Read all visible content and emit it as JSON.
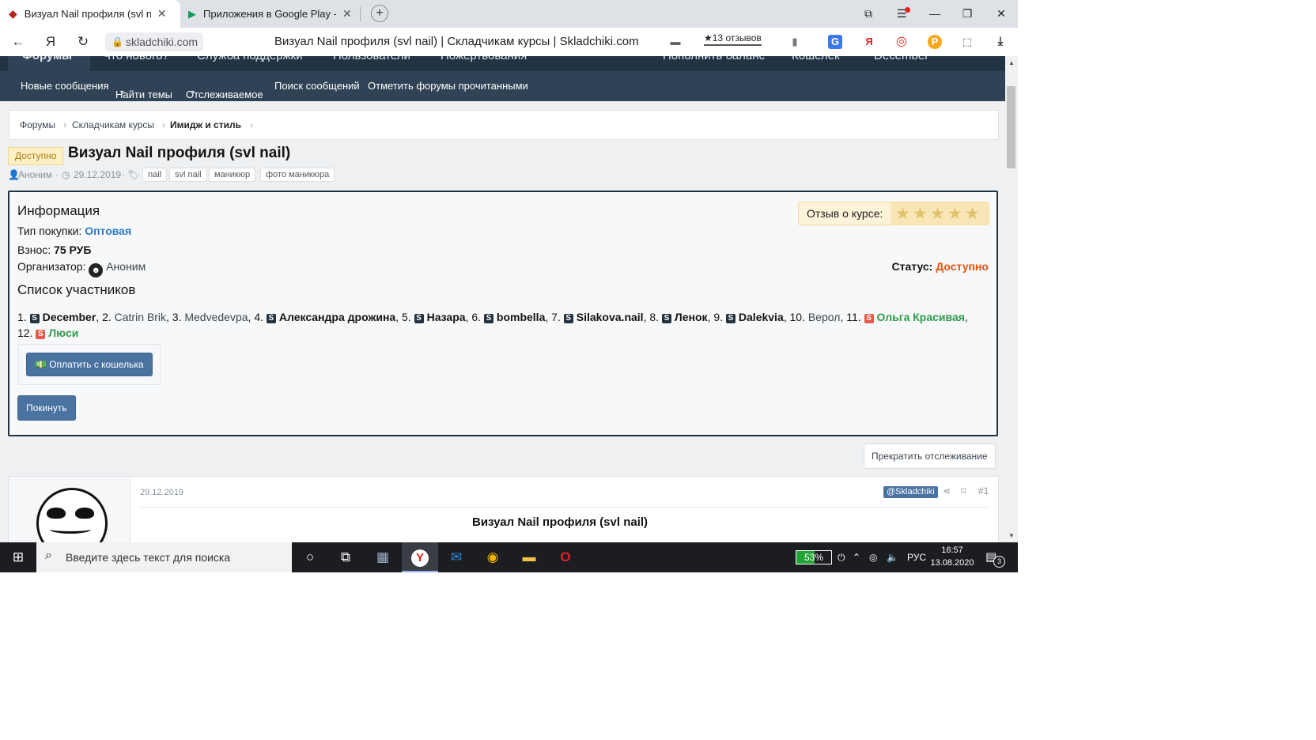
{
  "browser": {
    "tabs": [
      {
        "title": "Визуал Nail профиля (svl na",
        "close": "✕"
      },
      {
        "title": "Приложения в Google Play -",
        "close": "✕"
      }
    ],
    "address": "skladchiki.com",
    "page_title": "Визуал Nail профиля (svl nail) | Складчикам курсы | Skladchiki.com",
    "reviews": "★13 отзывов",
    "yandex_letter": "Я"
  },
  "forum_nav": {
    "top": [
      "Форумы",
      "Что нового?",
      "Служба поддержки",
      "Пользователи",
      "Пожертвования",
      "Пополнить баланс",
      "Кошелёк",
      "December"
    ],
    "sub": [
      "Новые сообщения",
      "Найти темы",
      "Отслеживаемое",
      "Поиск сообщений",
      "Отметить форумы прочитанными"
    ]
  },
  "breadcrumb": [
    "Форумы",
    "Складчикам курсы",
    "Имидж и стиль"
  ],
  "thread": {
    "status_badge": "Доступно",
    "title": "Визуал Nail профиля (svl nail)",
    "author": "Аноним",
    "date": "29.12.2019",
    "tags": [
      "nail",
      "svl nail",
      "маникюр",
      "фото маникюра"
    ]
  },
  "info": {
    "heading": "Информация",
    "purchase_type_label": "Тип покупки:",
    "purchase_type_value": "Оптовая",
    "fee_label": "Взнос:",
    "fee_value": "75 РУБ",
    "organizer_label": "Организатор:",
    "organizer_value": "Аноним",
    "rating_label": "Отзыв о курсе:",
    "rating_stars": 5,
    "status_label": "Статус:",
    "status_value": "Доступно",
    "participants_heading": "Список участников",
    "participants_line1": [
      {
        "n": "1.",
        "name": "December",
        "s": "dark",
        "style": "b"
      },
      {
        "n": "2.",
        "name": "Catrin Brik",
        "s": "",
        "style": "n"
      },
      {
        "n": "3.",
        "name": "Medvedevpa",
        "s": "",
        "style": "n"
      },
      {
        "n": "4.",
        "name": "Александра дрожина",
        "s": "dark",
        "style": "b"
      },
      {
        "n": "5.",
        "name": "Назара",
        "s": "dark",
        "style": "b"
      },
      {
        "n": "6.",
        "name": "bombella",
        "s": "dark",
        "style": "b"
      },
      {
        "n": "7.",
        "name": "Silakova.nail",
        "s": "dark",
        "style": "b"
      },
      {
        "n": "8.",
        "name": "Ленок",
        "s": "dark",
        "style": "b"
      },
      {
        "n": "9.",
        "name": "Dalekvia",
        "s": "dark",
        "style": "b"
      },
      {
        "n": "10.",
        "name": "Верол",
        "s": "",
        "style": "n"
      },
      {
        "n": "11.",
        "name": "Ольга Красивая",
        "s": "red",
        "style": "g"
      }
    ],
    "participants_line2": [
      {
        "n": "12.",
        "name": "Люси",
        "s": "red",
        "style": "g"
      }
    ],
    "pay_button": "Оплатить с кошелька",
    "leave_button": "Покинуть"
  },
  "unwatch_button": "Прекратить отслеживание",
  "post": {
    "date": "29.12.2019",
    "mention": "@Skladchiki",
    "number": "#1",
    "title": "Визуал Nail профиля (svl nail)"
  },
  "taskbar": {
    "search_placeholder": "Введите здесь текст для поиска",
    "battery_percent": 53,
    "battery_text": "53%",
    "language": "РУС",
    "time": "16:57",
    "date": "13.08.2020",
    "notifications": "3"
  },
  "colors": {
    "nav_dark": "#223344",
    "nav_sub": "#304356",
    "accent_button": "#4a73a2",
    "status_orange": "#e7540b",
    "member_green": "#2e9b48"
  }
}
